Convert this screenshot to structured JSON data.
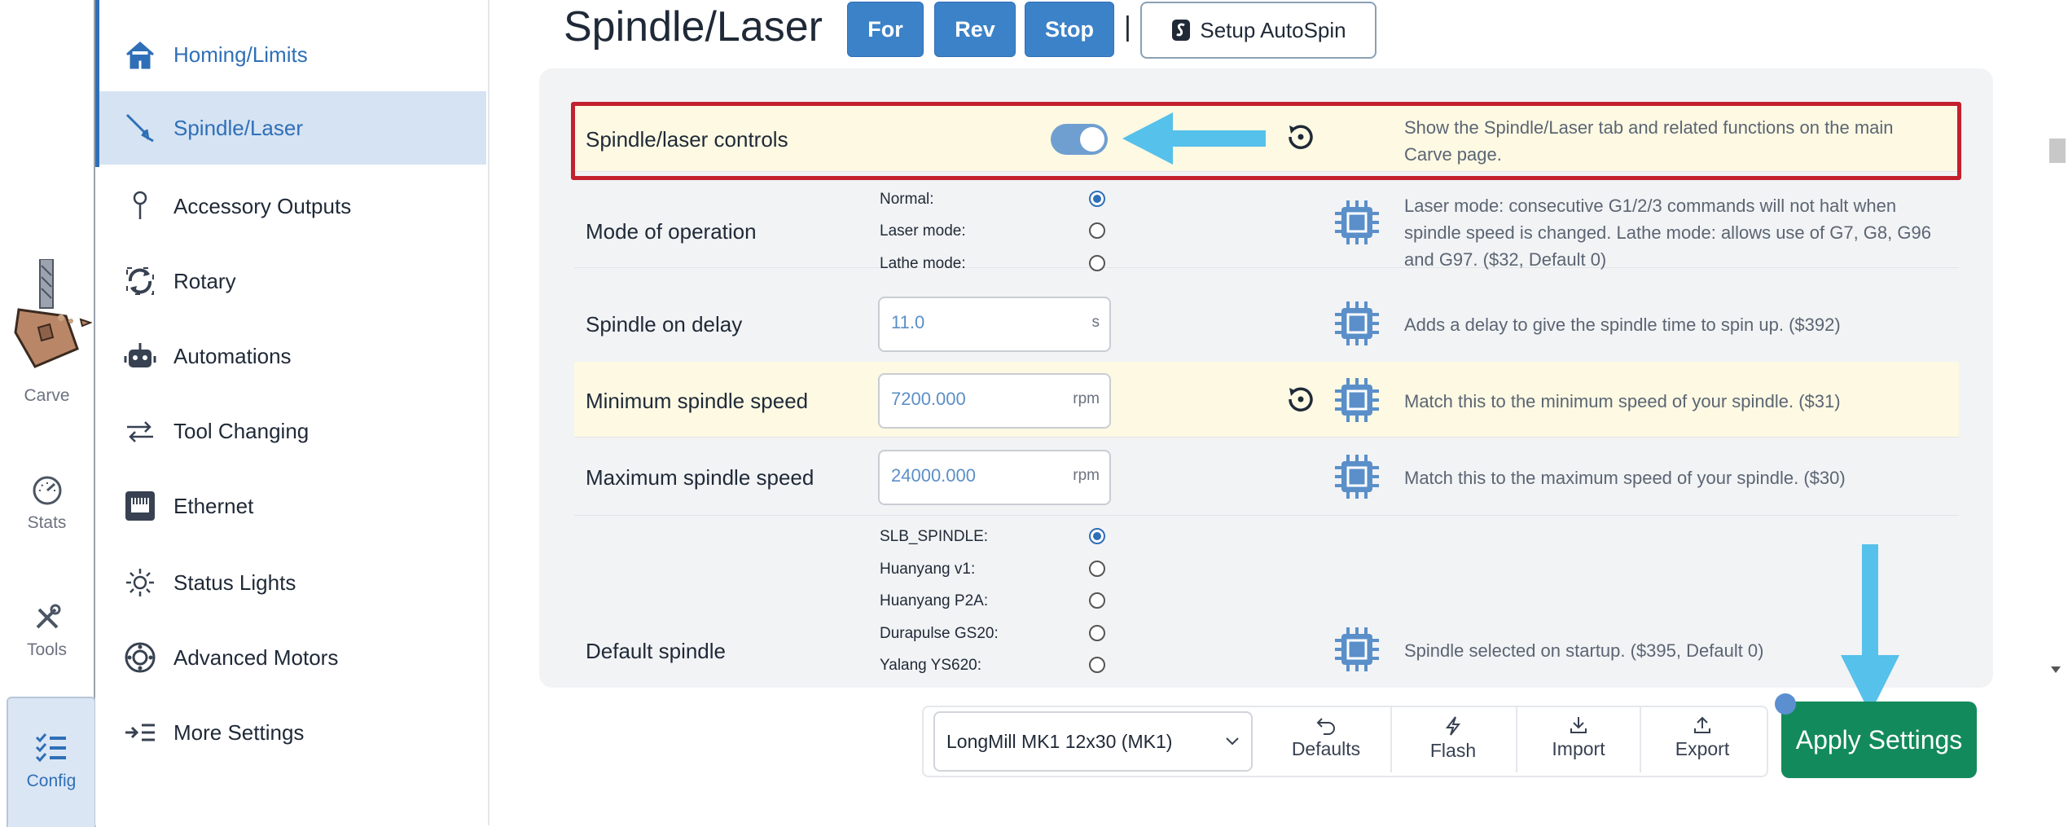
{
  "app_nav": {
    "items": [
      {
        "label": "Carve",
        "icon": "carve-bit-icon"
      },
      {
        "label": "Stats",
        "icon": "gauge-icon"
      },
      {
        "label": "Tools",
        "icon": "tools-icon"
      },
      {
        "label": "Config",
        "icon": "list-check-icon"
      }
    ],
    "active": "Config"
  },
  "sidebar": {
    "items": [
      {
        "label": "Homing/Limits",
        "icon": "home-icon"
      },
      {
        "label": "Spindle/Laser",
        "icon": "spindle-icon"
      },
      {
        "label": "Accessory Outputs",
        "icon": "pin-icon"
      },
      {
        "label": "Rotary",
        "icon": "rotary-icon"
      },
      {
        "label": "Automations",
        "icon": "robot-icon"
      },
      {
        "label": "Tool Changing",
        "icon": "arrows-swap-icon"
      },
      {
        "label": "Ethernet",
        "icon": "ethernet-icon"
      },
      {
        "label": "Status Lights",
        "icon": "sun-icon"
      },
      {
        "label": "Advanced Motors",
        "icon": "motor-icon"
      },
      {
        "label": "More Settings",
        "icon": "more-settings-icon"
      }
    ],
    "active": "Spindle/Laser"
  },
  "header": {
    "title": "Spindle/Laser",
    "buttons": [
      "For",
      "Rev",
      "Stop"
    ],
    "separator": "|",
    "autospin_label": "Setup AutoSpin"
  },
  "settings": {
    "spindle_laser_controls": {
      "label": "Spindle/laser controls",
      "enabled": true,
      "description": "Show the Spindle/Laser tab and related functions on the main Carve page."
    },
    "mode_of_operation": {
      "label": "Mode of operation",
      "options": [
        "Normal:",
        "Laser mode:",
        "Lathe mode:"
      ],
      "selected": "Normal:",
      "description": "Laser mode: consecutive G1/2/3 commands will not halt when spindle speed is changed. Lathe mode: allows use of G7, G8, G96 and G97. ($32, Default 0)"
    },
    "spindle_on_delay": {
      "label": "Spindle on delay",
      "value": "11.0",
      "unit": "s",
      "description": "Adds a delay to give the spindle time to spin up. ($392)"
    },
    "min_spindle_speed": {
      "label": "Minimum spindle speed",
      "value": "7200.000",
      "unit": "rpm",
      "description": "Match this to the minimum speed of your spindle. ($31)"
    },
    "max_spindle_speed": {
      "label": "Maximum spindle speed",
      "value": "24000.000",
      "unit": "rpm",
      "description": "Match this to the maximum speed of your spindle. ($30)"
    },
    "default_spindle": {
      "label": "Default spindle",
      "options": [
        "SLB_SPINDLE:",
        "Huanyang v1:",
        "Huanyang P2A:",
        "Durapulse GS20:",
        "Yalang YS620:"
      ],
      "selected": "SLB_SPINDLE:",
      "description": "Spindle selected on startup. ($395, Default 0)"
    }
  },
  "footer": {
    "machine": "LongMill MK1 12x30 (MK1)",
    "actions": [
      {
        "label": "Defaults",
        "icon": "undo-icon"
      },
      {
        "label": "Flash",
        "icon": "flash-icon"
      },
      {
        "label": "Import",
        "icon": "import-icon"
      },
      {
        "label": "Export",
        "icon": "export-icon"
      }
    ],
    "apply_label": "Apply Settings"
  },
  "colors": {
    "accent": "#3c82c8",
    "highlight_row": "#fdf9e3",
    "annotation_box": "#c3202e",
    "annotation_arrow": "#56c1ea",
    "apply": "#138a5b"
  }
}
